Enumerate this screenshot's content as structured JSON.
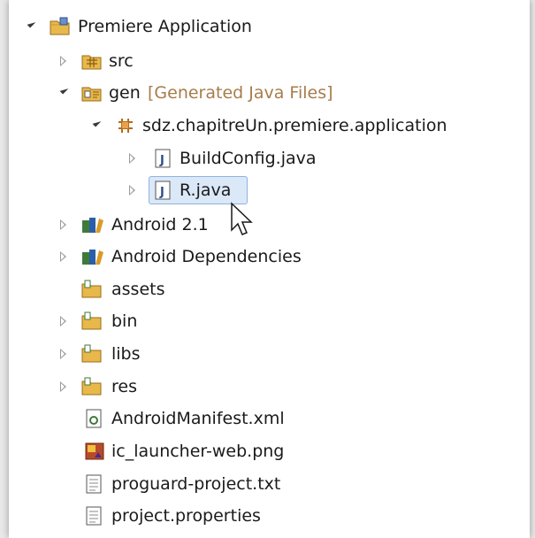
{
  "tree": {
    "project": {
      "label": "Premiere Application"
    },
    "src": {
      "label": "src"
    },
    "gen": {
      "label": "gen",
      "decoration": "[Generated Java Files]"
    },
    "package": {
      "label": "sdz.chapitreUn.premiere.application"
    },
    "buildconfig": {
      "label": "BuildConfig.java"
    },
    "rjava": {
      "label": "R.java"
    },
    "android": {
      "label": "Android 2.1"
    },
    "deps": {
      "label": "Android Dependencies"
    },
    "assets": {
      "label": "assets"
    },
    "bin": {
      "label": "bin"
    },
    "libs": {
      "label": "libs"
    },
    "res": {
      "label": "res"
    },
    "manifest": {
      "label": "AndroidManifest.xml"
    },
    "launcher": {
      "label": "ic_launcher-web.png"
    },
    "proguard": {
      "label": "proguard-project.txt"
    },
    "properties": {
      "label": "project.properties"
    }
  },
  "colors": {
    "folder": "#e8b84a",
    "selection": "#dbe8f7",
    "decoration": "#a77c4a"
  }
}
